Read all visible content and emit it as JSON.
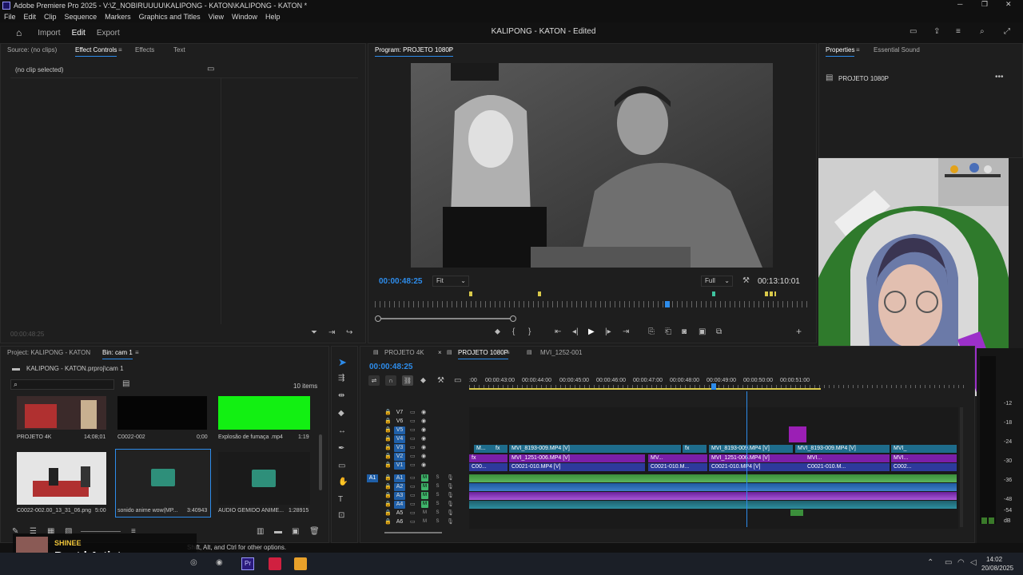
{
  "app": {
    "title": "Adobe Premiere Pro 2025 - V:\\Z_NOBIRUUUU\\KALIPONG - KATON\\KALIPONG - KATON *",
    "document_title": "KALIPONG - KATON - Edited"
  },
  "menu": [
    "File",
    "Edit",
    "Clip",
    "Sequence",
    "Markers",
    "Graphics and Titles",
    "View",
    "Window",
    "Help"
  ],
  "workspaces": {
    "import": "Import",
    "edit": "Edit",
    "export": "Export"
  },
  "source_panel": {
    "tabs": [
      "Source: (no clips)",
      "Effect Controls",
      "Effects",
      "Text"
    ],
    "no_clip": "(no clip selected)",
    "timecode": "00:00:48:25"
  },
  "program": {
    "title": "Program: PROJETO 1080P",
    "timecode": "00:00:48:25",
    "fit": "Fit",
    "quality": "Full",
    "duration": "00:13:10:01"
  },
  "properties": {
    "tabs": [
      "Properties",
      "Essential Sound"
    ],
    "item": "PROJETO 1080P"
  },
  "project": {
    "title": "Project: KALIPONG - KATON",
    "bin": "Bin: cam 1",
    "path": "KALIPONG - KATON.prproj\\cam 1",
    "count": "10 items",
    "items": [
      {
        "name": "PROJETO 4K",
        "dur": "14;08;01"
      },
      {
        "name": "C0022-002",
        "dur": "0;00"
      },
      {
        "name": "Explosão de fumaça .mp4",
        "dur": "1:19"
      },
      {
        "name": "C0022-002.00_13_31_06.png",
        "dur": "5:00"
      },
      {
        "name": "sonido anime wow(MP...",
        "dur": "3:40943"
      },
      {
        "name": "AUDIO GEMIDO ANIME...",
        "dur": "1:28915"
      }
    ]
  },
  "timeline": {
    "tabs": [
      "PROJETO 4K",
      "PROJETO 1080P",
      "MVI_1252-001"
    ],
    "timecode": "00:00:48:25",
    "ruler": [
      ":00",
      "00:00:43:00",
      "00:00:44:00",
      "00:00:45:00",
      "00:00:46:00",
      "00:00:47:00",
      "00:00:48:00",
      "00:00:49:00",
      "00:00:50:00",
      "00:00:51:00"
    ],
    "video_tracks": [
      "V7",
      "V6",
      "V5",
      "V4",
      "V3",
      "V2",
      "V1"
    ],
    "audio_tracks": [
      "A1",
      "A2",
      "A3",
      "A4",
      "A5",
      "A6"
    ],
    "clips": {
      "v3": [
        "M...",
        "fx",
        "MVI_8193-009.MP4 [V]",
        "fx",
        "MVI_8193-009.MP4 [V]",
        "MVI_8193-009.MP4 [V]",
        "MVI_"
      ],
      "v2": [
        "fx",
        "MVI_1251-006.MP4 [V]",
        "MV...",
        "MVI_1251-006.MP4 [V]",
        "MVI...",
        "MVI..."
      ],
      "v1": [
        "C00...",
        "C0021-010.MP4 [V]",
        "C0021-010.M...",
        "C0021-010.MP4 [V]",
        "C0021-010.M...",
        "C002..."
      ]
    }
  },
  "meter": [
    "-12",
    "-18",
    "-24",
    "-30",
    "-36",
    "-42",
    "-48",
    "-54",
    "dB"
  ],
  "status": {
    "hint": "Shift, Alt, and Ctrl for other options."
  },
  "overlay": {
    "artist": "SHINEE",
    "song": "Poet | Artist"
  },
  "taskbar": {
    "time": "14:02",
    "date": "20/08/2025"
  }
}
